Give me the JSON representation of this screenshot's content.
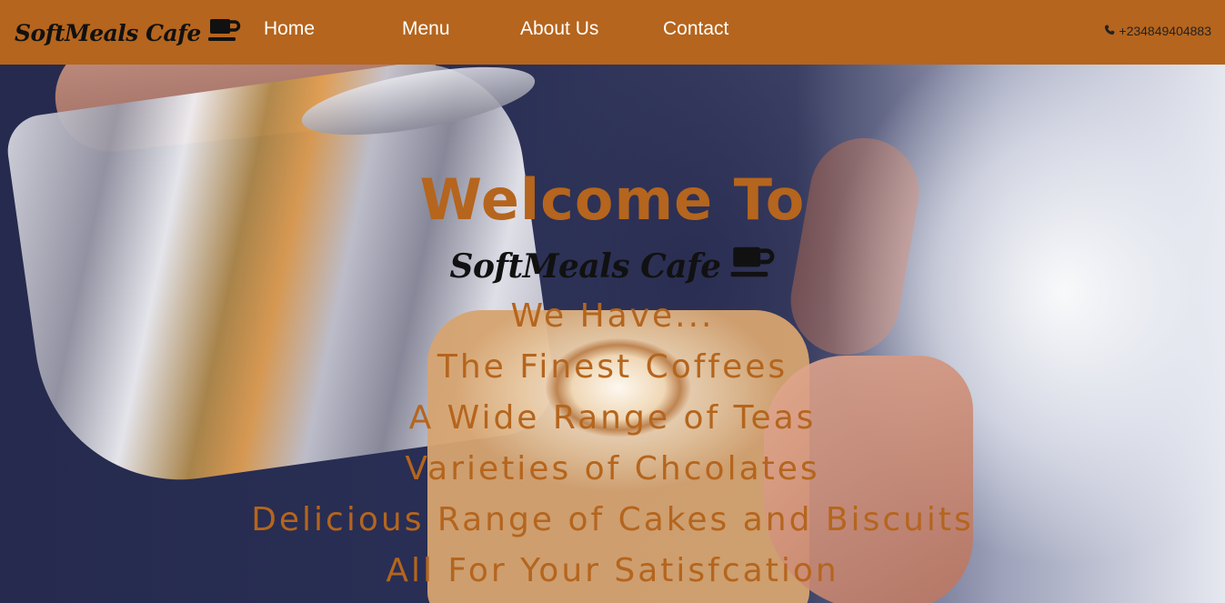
{
  "navbar": {
    "brand": "SoftMeals Cafe",
    "brand_icon": "coffee-cup-icon",
    "links": [
      "Home",
      "Menu",
      "About Us",
      "Contact"
    ],
    "phone_icon": "phone-icon",
    "phone": "+234849404883",
    "background_color": "#b5651d"
  },
  "hero": {
    "welcome": "Welcome To",
    "brand": "SoftMeals Cafe",
    "brand_icon": "coffee-cup-icon",
    "intro": "We Have...",
    "items": [
      "The Finest Coffees",
      "A Wide Range of Teas",
      "Varieties of Chcolates",
      "Delicious Range of Cakes and Biscuits",
      "All For Your Satisfcation"
    ],
    "text_color": "#b5651d"
  }
}
